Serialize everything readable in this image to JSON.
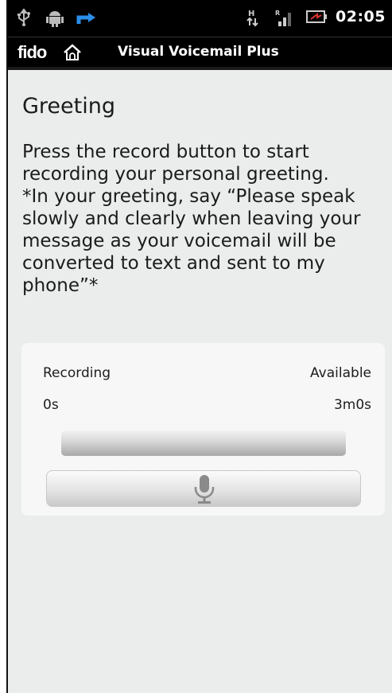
{
  "status_bar": {
    "time": "02:05",
    "icons": [
      "usb-icon",
      "android-debug-icon",
      "transfer-icon",
      "hspa-data-icon",
      "signal-icon",
      "battery-charging-icon"
    ]
  },
  "app_bar": {
    "logo": "fido",
    "title": "Visual Voicemail Plus"
  },
  "main": {
    "heading": "Greeting",
    "instructions": "Press the record button to start\nrecording your personal greeting.\n*In your greeting, say “Please speak\nslowly and clearly when leaving your\nmessage as your voicemail will be\nconverted to text and sent to my\nphone”*"
  },
  "recorder": {
    "recording_label": "Recording",
    "available_label": "Available",
    "recording_value": "0s",
    "available_value": "3m0s",
    "progress_fraction": 0,
    "record_button_icon": "microphone-icon"
  }
}
